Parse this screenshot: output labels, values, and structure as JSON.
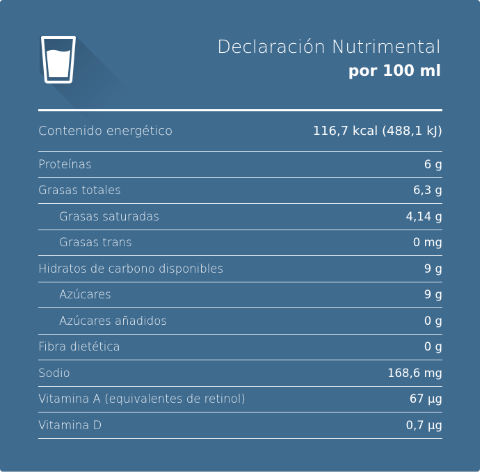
{
  "header": {
    "title": "Declaración Nutrimental",
    "subtitle": "por 100 ml",
    "icon": "glass-of-milk-icon"
  },
  "colors": {
    "background": "#3f6b8f",
    "text": "#ffffff"
  },
  "nutrients": [
    {
      "label": "Contenido energético",
      "value": "116,7 kcal (488,1 kJ)",
      "indent": false
    },
    {
      "label": "Proteínas",
      "value": "6 g",
      "indent": false
    },
    {
      "label": "Grasas totales",
      "value": "6,3 g",
      "indent": false
    },
    {
      "label": "Grasas saturadas",
      "value": "4,14 g",
      "indent": true
    },
    {
      "label": "Grasas trans",
      "value": "0 mg",
      "indent": true
    },
    {
      "label": "Hidratos de carbono disponibles",
      "value": "9 g",
      "indent": false
    },
    {
      "label": "Azúcares",
      "value": "9 g",
      "indent": true
    },
    {
      "label": "Azúcares añadidos",
      "value": "0 g",
      "indent": true
    },
    {
      "label": "Fibra dietética",
      "value": "0 g",
      "indent": false
    },
    {
      "label": "Sodio",
      "value": "168,6 mg",
      "indent": false
    },
    {
      "label": "Vitamina A (equivalentes de retinol)",
      "value": "67 µg",
      "indent": false
    },
    {
      "label": "Vitamina D",
      "value": "0,7 µg",
      "indent": false
    }
  ]
}
